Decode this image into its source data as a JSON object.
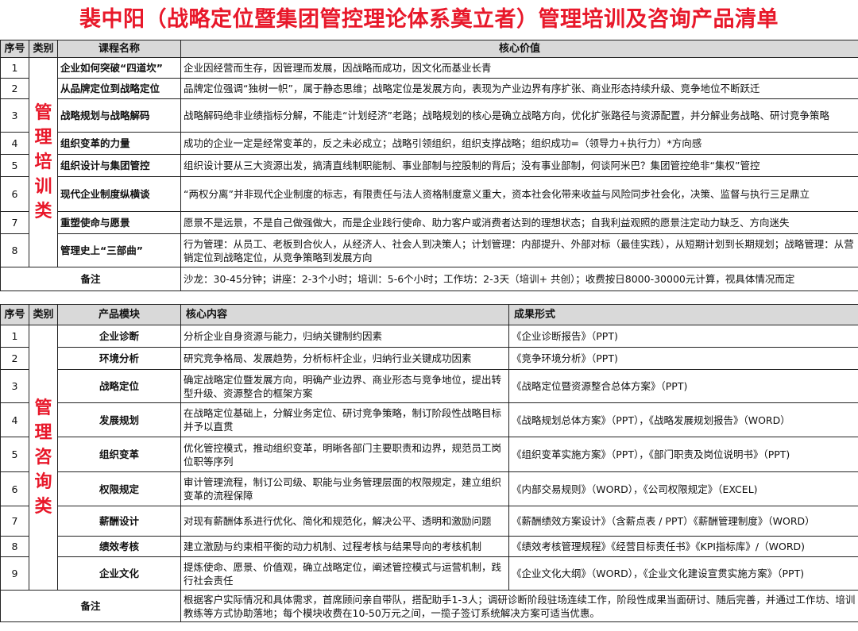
{
  "title": "裴中阳（战略定位暨集团管控理论体系奠立者）管理培训及咨询产品清单",
  "training": {
    "headers": [
      "序号",
      "类别",
      "课程名称",
      "核心价值"
    ],
    "category_chars": [
      "管",
      "理",
      "培",
      "训",
      "类"
    ],
    "rows": [
      {
        "no": "1",
        "name": "企业如何突破“四道坎”",
        "value": "企业因经营而生存，因管理而发展，因战略而成功，因文化而基业长青"
      },
      {
        "no": "2",
        "name": "从品牌定位到战略定位",
        "value": "品牌定位强调“独树一帜”，属于静态思维；战略定位是发展方向，表现为产业边界有序扩张、商业形态持续升级、竞争地位不断跃迁"
      },
      {
        "no": "3",
        "name": "战略规划与战略解码",
        "value": "战略解码绝非业绩指标分解，不能走“计划经济”老路；战略规划的核心是确立战略方向，优化扩张路径与资源配置，并分解业务战略、研讨竞争策略"
      },
      {
        "no": "4",
        "name": "组织变革的力量",
        "value": "成功的企业一定是经常变革的，反之未必成立；战略引领组织，组织支撑战略；组织成功=（领导力+执行力）*方向感"
      },
      {
        "no": "5",
        "name": "组织设计与集团管控",
        "value": "组织设计要从三大资源出发，搞清直线制职能制、事业部制与控股制的背后；没有事业部制，何谈阿米巴？集团管控绝非“集权”管控"
      },
      {
        "no": "6",
        "name": "现代企业制度纵横谈",
        "value": "“两权分离”并非现代企业制度的标志，有限责任与法人资格制度意义重大，资本社会化带来收益与风险同步社会化，决策、监督与执行三足鼎立"
      },
      {
        "no": "7",
        "name": "重塑使命与愿景",
        "value": "愿景不是远景，不是自己做强做大，而是企业践行使命、助力客户或消费者达到的理想状态；自我利益观照的愿景注定动力缺乏、方向迷失"
      },
      {
        "no": "8",
        "name": "管理史上“三部曲”",
        "value": "行为管理：从员工、老板到合伙人，从经济人、社会人到决策人；计划管理：内部提升、外部对标（最佳实践），从短期计划到长期规划；战略管理：从营销定位到战略定位，从竞争策略到发展方向"
      }
    ],
    "note_label": "备注",
    "note": "沙龙：30-45分钟；讲座：2-3个小时；培训：5-6个小时；工作坊：2-3天（培训+ 共创）；收费按日8000-30000元计算，视具体情况而定"
  },
  "consulting": {
    "headers": [
      "序号",
      "类别",
      "产品模块",
      "核心内容",
      "成果形式"
    ],
    "category_chars": [
      "管",
      "理",
      "咨",
      "询",
      "类"
    ],
    "rows": [
      {
        "no": "1",
        "module": "企业诊断",
        "content": "分析企业自身资源与能力，归纳关键制约因素",
        "result": "《企业诊断报告》（PPT)"
      },
      {
        "no": "2",
        "module": "环境分析",
        "content": "研究竞争格局、发展趋势，分析标杆企业，归纳行业关键成功因素",
        "result": "《竞争环境分析》（PPT)"
      },
      {
        "no": "3",
        "module": "战略定位",
        "content": "确定战略定位暨发展方向，明确产业边界、商业形态与竞争地位，提出转型升级、资源整合的框架方案",
        "result": "《战略定位暨资源整合总体方案》（PPT)"
      },
      {
        "no": "4",
        "module": "发展规划",
        "content": "在战略定位基础上，分解业务定位、研讨竞争策略，制订阶段性战略目标并予以直贯",
        "result": "《战略规划总体方案》（PPT），《战略发展规划报告》（WORD）"
      },
      {
        "no": "5",
        "module": "组织变革",
        "content": "优化管控模式，推动组织变革，明晰各部门主要职责和边界，规范员工岗位职等序列",
        "result": "《组织变革实施方案》（PPT），《部门职责及岗位说明书》（PPT)"
      },
      {
        "no": "6",
        "module": "权限规定",
        "content": "审计管理流程，制订公司级、职能与业务管理层面的权限规定，建立组织变革的流程保障",
        "result": "《内部交易规则》（WORD），《公司权限规定》（EXCEL)"
      },
      {
        "no": "7",
        "module": "薪酬设计",
        "content": "对现有薪酬体系进行优化、简化和规范化，解决公平、透明和激励问题",
        "result": "《薪酬绩效方案设计》（含薪点表 / PPT）《薪酬管理制度》（WORD）"
      },
      {
        "no": "8",
        "module": "绩效考核",
        "content": "建立激励与约束相平衡的动力机制、过程考核与结果导向的考核机制",
        "result": "《绩效考核管理规程》《经营目标责任书》《KPI指标库》/（WORD)"
      },
      {
        "no": "9",
        "module": "企业文化",
        "content": "提炼使命、愿景、价值观，确立战略定位，阐述管控模式与运营机制，践行社会责任",
        "result": "《企业文化大纲》（WORD），《企业文化建设宣贯实施方案》（PPT)"
      }
    ],
    "note_label": "备注",
    "note": "根据客户实际情况和具体需求，首席顾问亲自带队，搭配助手1-3人；调研诊断阶段驻场连续工作，阶段性成果当面研讨、随后完善，并通过工作坊、培训教练等方式协助落地；每个模块收费在10-50万元之间，一揽子签订系统解决方案可适当优惠。"
  }
}
